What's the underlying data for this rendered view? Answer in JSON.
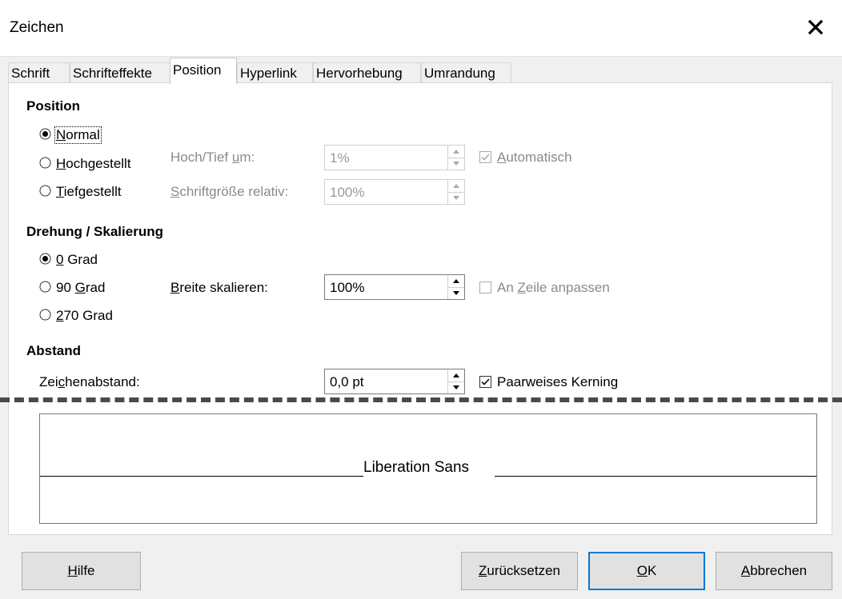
{
  "window": {
    "title": "Zeichen"
  },
  "tabs": [
    "Schrift",
    "Schrifteffekte",
    "Position",
    "Hyperlink",
    "Hervorhebung",
    "Umrandung"
  ],
  "active_tab": "Position",
  "position": {
    "heading": "Position",
    "options": [
      {
        "pre": "",
        "mn": "N",
        "post": "ormal",
        "selected": true
      },
      {
        "pre": "",
        "mn": "H",
        "post": "ochgestellt",
        "selected": false
      },
      {
        "pre": "",
        "mn": "T",
        "post": "iefgestellt",
        "selected": false
      }
    ],
    "raise_label": {
      "pre": "Hoch/Tief ",
      "mn": "u",
      "post": "m:"
    },
    "raise_value": "1%",
    "relsize_label": {
      "pre": "",
      "mn": "S",
      "post": "chriftgröße relativ:"
    },
    "relsize_value": "100%",
    "auto_label": {
      "pre": "",
      "mn": "A",
      "post": "utomatisch"
    },
    "auto_checked": true
  },
  "rotation": {
    "heading": "Drehung / Skalierung",
    "options": [
      {
        "pre": "",
        "mn": "0",
        "post": " Grad",
        "selected": true
      },
      {
        "pre": "90 ",
        "mn": "G",
        "post": "rad",
        "selected": false
      },
      {
        "pre": "",
        "mn": "2",
        "post": "70 Grad",
        "selected": false
      }
    ],
    "scale_label": {
      "pre": "",
      "mn": "B",
      "post": "reite skalieren:"
    },
    "scale_value": "100%",
    "fit_label": {
      "pre": "An ",
      "mn": "Z",
      "post": "eile anpassen"
    },
    "fit_checked": false
  },
  "spacing": {
    "heading": "Abstand",
    "label": {
      "pre": "Zei",
      "mn": "c",
      "post": "henabstand:"
    },
    "value": "0,0 pt",
    "kerning_label": "Paarweises Kerning",
    "kerning_checked": true
  },
  "preview": {
    "text": "Liberation Sans"
  },
  "buttons": {
    "help": {
      "pre": "",
      "mn": "H",
      "post": "ilfe"
    },
    "reset": {
      "pre": "",
      "mn": "Z",
      "post": "urücksetzen"
    },
    "ok": {
      "pre": "",
      "mn": "O",
      "post": "K"
    },
    "cancel": {
      "pre": "",
      "mn": "A",
      "post": "bbrechen"
    }
  },
  "icons": {
    "close": "close-icon",
    "radio": "radio-icon",
    "checkbox": "checkbox-icon",
    "spin_up": "triangle-up-icon",
    "spin_down": "triangle-down-icon"
  },
  "colors": {
    "accent": "#0078d7",
    "disabled_text": "#8a8a8a",
    "dialog_bg": "#f0f0f0"
  }
}
